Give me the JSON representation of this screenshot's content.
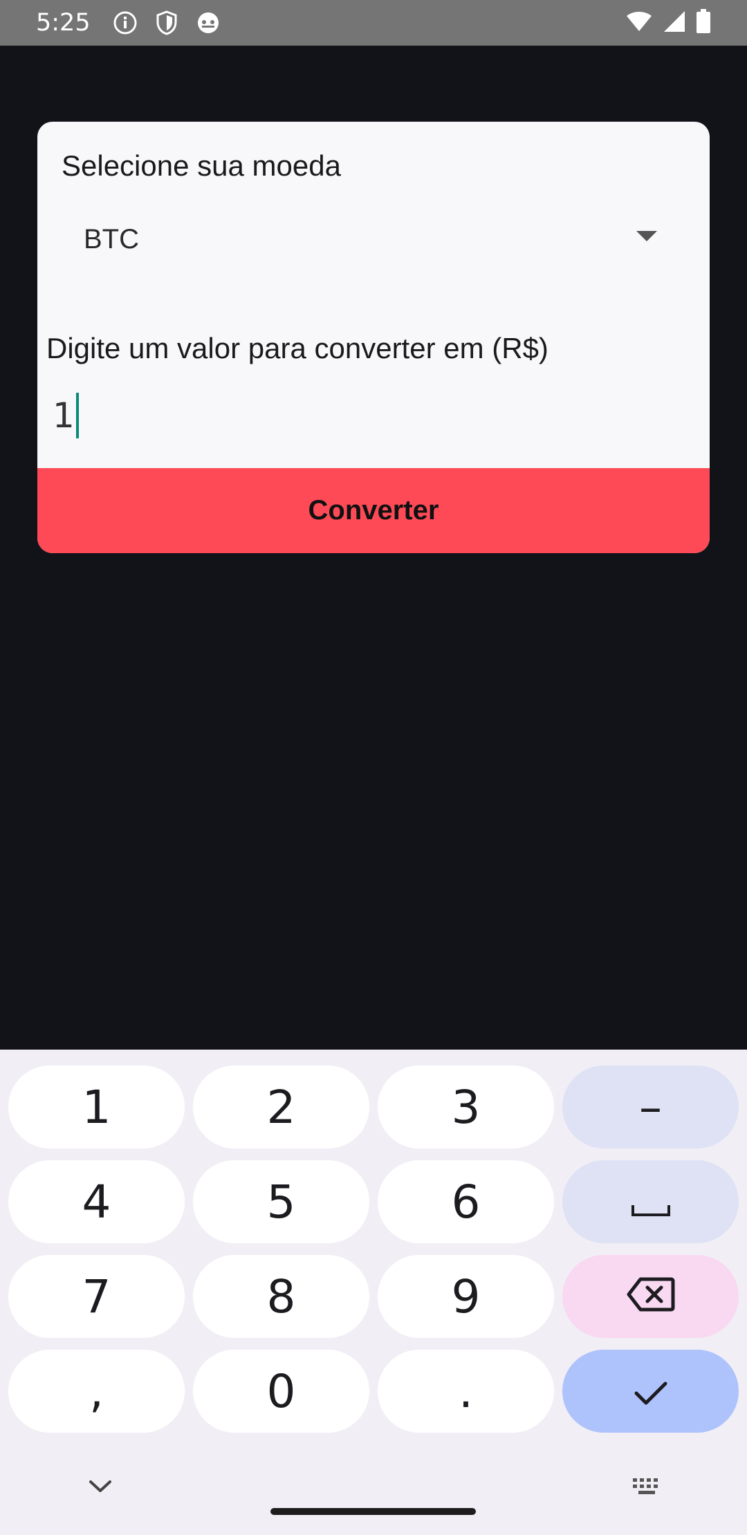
{
  "status_bar": {
    "time": "5:25",
    "left_icons": [
      "info-icon",
      "shield-icon",
      "android-head-icon"
    ],
    "right_icons": [
      "wifi-icon",
      "cell-signal-icon",
      "battery-icon"
    ]
  },
  "card": {
    "currency_label": "Selecione sua moeda",
    "currency_selected": "BTC",
    "value_label": "Digite um valor para converter em (R$)",
    "value_input": "1",
    "convert_button": "Converter"
  },
  "keyboard": {
    "keys": {
      "k1": "1",
      "k2": "2",
      "k3": "3",
      "minus": "–",
      "k4": "4",
      "k5": "5",
      "k6": "6",
      "k7": "7",
      "k8": "8",
      "k9": "9",
      "comma": ",",
      "k0": "0",
      "period": "."
    },
    "special_icons": [
      "space-icon",
      "backspace-icon",
      "check-icon",
      "chevron-down-icon",
      "keyboard-icon"
    ]
  },
  "colors": {
    "background": "#121318",
    "card": "#f8f7f9",
    "accent_button": "#fe4a57",
    "cursor": "#0a8a7a",
    "keyboard_bg": "#f1eff5",
    "key_mod": "#dfe1f5",
    "key_delete": "#f9d8f2",
    "key_done": "#aec2fb"
  }
}
